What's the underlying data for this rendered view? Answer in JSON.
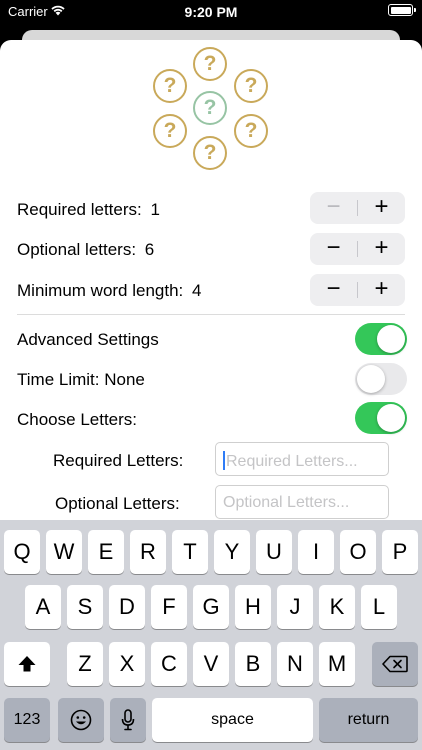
{
  "status_bar": {
    "carrier": "Carrier",
    "time": "9:20 PM"
  },
  "puzzle": {
    "glyph": "?",
    "outer_color": "#c9a95a",
    "center_color": "#97c4a4"
  },
  "settings": {
    "required_letters_label": "Required letters:",
    "required_letters_value": "1",
    "optional_letters_label": "Optional letters:",
    "optional_letters_value": "6",
    "min_word_length_label": "Minimum word length:",
    "min_word_length_value": "4",
    "stepper_minus": "−",
    "stepper_plus": "+",
    "advanced_label": "Advanced Settings",
    "advanced_on": true,
    "time_limit_label": "Time Limit: None",
    "time_limit_on": false,
    "choose_letters_label": "Choose Letters:",
    "choose_letters_on": true
  },
  "fields": {
    "required_label": "Required Letters:",
    "required_placeholder": "Required Letters...",
    "optional_label": "Optional Letters:",
    "optional_placeholder": "Optional Letters..."
  },
  "keyboard": {
    "row1": [
      "Q",
      "W",
      "E",
      "R",
      "T",
      "Y",
      "U",
      "I",
      "O",
      "P"
    ],
    "row2": [
      "A",
      "S",
      "D",
      "F",
      "G",
      "H",
      "J",
      "K",
      "L"
    ],
    "row3": [
      "Z",
      "X",
      "C",
      "V",
      "B",
      "N",
      "M"
    ],
    "numbers_key": "123",
    "space_key": "space",
    "return_key": "return",
    "toggle_on_color": "#34c759"
  }
}
